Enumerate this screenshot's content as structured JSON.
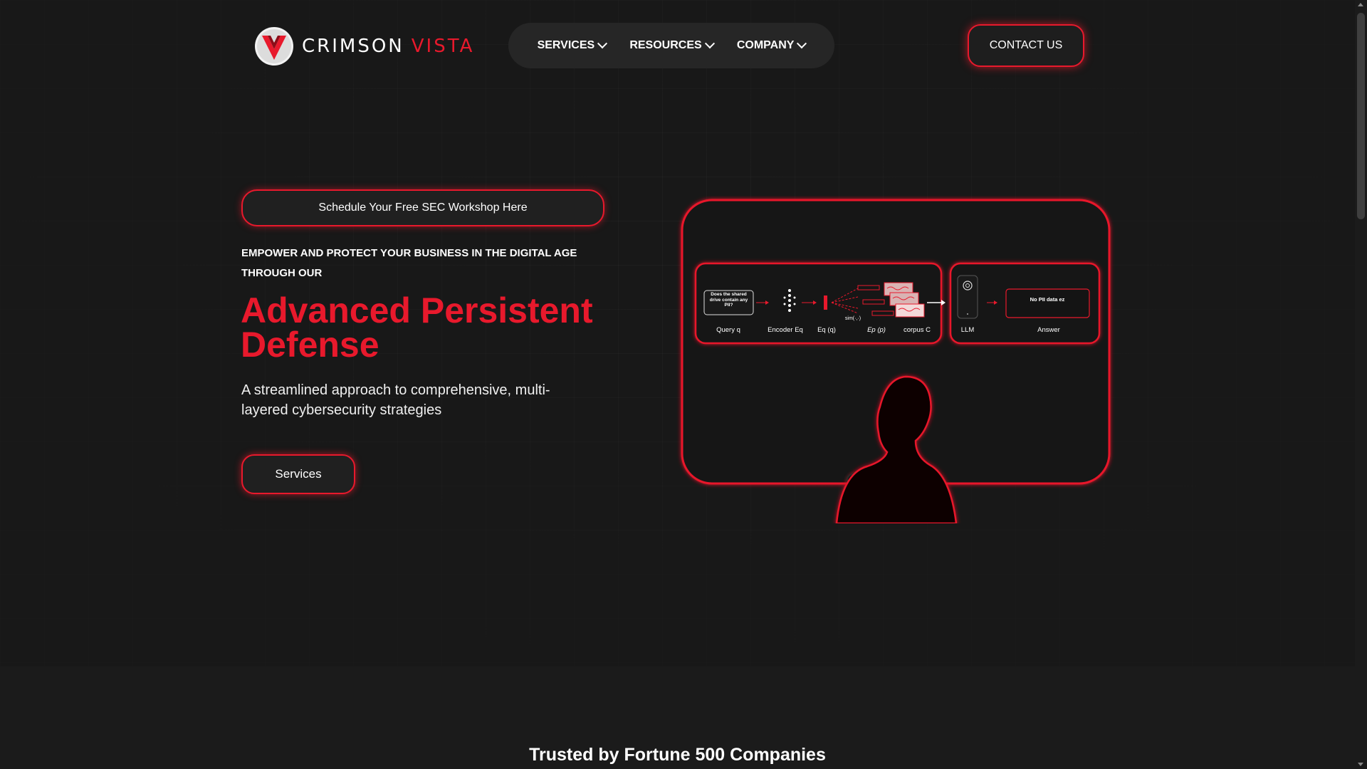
{
  "brand": {
    "name_part1": "CRIMSON",
    "name_part2": "VISTA",
    "accent_color": "#e8192c",
    "logo_icon": "v-shield-logo-icon"
  },
  "nav": {
    "items": [
      {
        "label": "SERVICES",
        "icon": "chevron-down-icon"
      },
      {
        "label": "RESOURCES",
        "icon": "chevron-down-icon"
      },
      {
        "label": "COMPANY",
        "icon": "chevron-down-icon"
      }
    ],
    "contact_label": "CONTACT US"
  },
  "hero": {
    "workshop_cta": "Schedule Your Free SEC Workshop Here",
    "eyebrow": "EMPOWER AND PROTECT YOUR BUSINESS IN THE DIGITAL AGE THROUGH OUR",
    "headline": "Advanced Persistent Defense",
    "subtitle": "A streamlined approach to comprehensive, multi-layered cybersecurity strategies",
    "services_cta": "Services"
  },
  "illustration": {
    "query_text": "Does the shared drive contain any PII?",
    "answer_text": "No PII data ez",
    "labels": {
      "query": "Query q",
      "encoder": "Encoder Eq",
      "eq": "Eq (q)",
      "sim": "sim(·,·)",
      "ep": "Ep (p)",
      "corpus": "corpus C",
      "llm": "LLM",
      "answer": "Answer"
    }
  },
  "trusted": {
    "heading": "Trusted by Fortune 500 Companies"
  }
}
